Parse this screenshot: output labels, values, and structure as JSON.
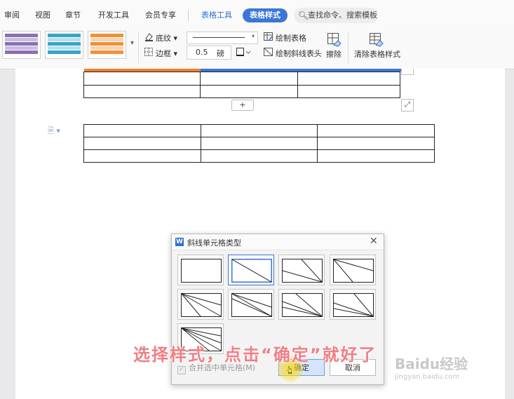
{
  "menubar": {
    "items": [
      "审阅",
      "视图",
      "章节",
      "开发工具",
      "会员专享"
    ],
    "table_tools": "表格工具",
    "table_style": "表格样式",
    "search_text": "查找命令、搜索模板"
  },
  "ribbon": {
    "shading_label": "底纹",
    "border_label": "边框",
    "line_width": "0.5",
    "line_width_unit": "磅",
    "draw_table_label": "绘制表格",
    "draw_diagonal_label": "绘制斜线表头",
    "erase_label": "擦除",
    "clear_style_label": "清除表格样式",
    "swatch_colors": [
      "#8b6fb5",
      "#3aa3c9",
      "#f0913a"
    ]
  },
  "document": {
    "add_row_label": "+"
  },
  "dialog": {
    "title": "斜线单元格类型",
    "merge_label": "合并选中单元格(M)",
    "ok_label": "确定",
    "cancel_label": "取消"
  },
  "overlay": {
    "caption": "选择样式，点击“确定”就好了",
    "caption_color": "#f07f86",
    "watermark": "Baidu经验",
    "watermark_sub": "jingyan.baidu.com"
  },
  "colors": {
    "accent": "#3b75d8",
    "tool_blue": "#2f6fd1"
  }
}
